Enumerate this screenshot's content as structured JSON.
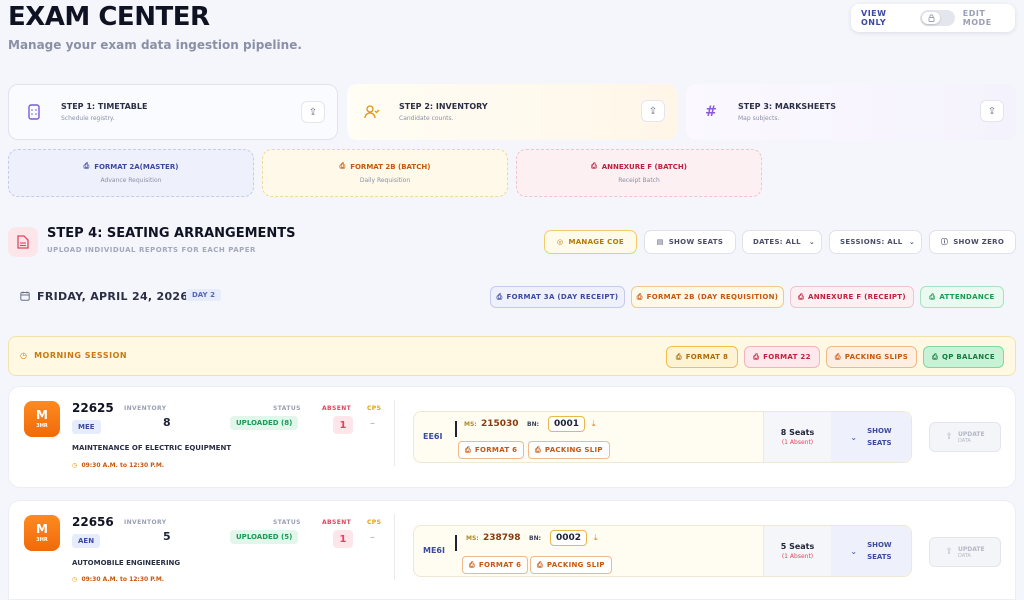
{
  "header": {
    "title": "EXAM CENTER",
    "subtitle": "Manage your exam data ingestion pipeline.",
    "mode_view": "VIEW ONLY",
    "mode_edit": "EDIT MODE"
  },
  "steps": [
    {
      "title": "STEP 1: TIMETABLE",
      "desc": "Schedule registry."
    },
    {
      "title": "STEP 2: INVENTORY",
      "desc": "Candidate counts."
    },
    {
      "title": "STEP 3: MARKSHEETS",
      "desc": "Map subjects."
    }
  ],
  "formats": [
    {
      "title": "FORMAT 2A(MASTER)",
      "desc": "Advance Requisition"
    },
    {
      "title": "FORMAT 2B (BATCH)",
      "desc": "Daily Requisition"
    },
    {
      "title": "ANNEXURE F (BATCH)",
      "desc": "Receipt Batch"
    }
  ],
  "step4": {
    "title": "STEP 4: SEATING ARRANGEMENTS",
    "subtitle": "UPLOAD INDIVIDUAL REPORTS FOR EACH PAPER",
    "manage_coe": "MANAGE COE",
    "show_seats": "SHOW SEATS",
    "dates_filter": "DATES: ALL",
    "sessions_filter": "SESSIONS: ALL",
    "show_zero": "SHOW ZERO"
  },
  "day": {
    "date": "FRIDAY, APRIL 24, 2026",
    "badge": "DAY 2",
    "actions": [
      "FORMAT 3A (DAY RECEIPT)",
      "FORMAT 2B (DAY REQUISITION)",
      "ANNEXURE F (RECEIPT)",
      "ATTENDANCE"
    ]
  },
  "session": {
    "label": "MORNING SESSION",
    "actions": [
      "FORMAT 8",
      "FORMAT 22",
      "PACKING SLIPS",
      "QP BALANCE"
    ]
  },
  "labels": {
    "inventory": "INVENTORY",
    "status": "STATUS",
    "absent": "ABSENT",
    "cps": "CPS",
    "ms": "MS:",
    "bn": "BN:",
    "format6": "FORMAT 6",
    "packing_slip": "PACKING SLIP",
    "show": "SHOW",
    "seats": "SEATS",
    "update": "UPDATE",
    "data": "DATA",
    "badge_letter": "M",
    "badge_hours": "3HR"
  },
  "papers": [
    {
      "code": "22625",
      "branch": "MEE",
      "inventory": "8",
      "status": "UPLOADED (8)",
      "absent": "1",
      "cps": "–",
      "name": "MAINTENANCE OF ELECTRIC EQUIPMENT",
      "time": "09:30 A.M. to 12:30 P.M.",
      "sub_code": "EE6I",
      "ms": "215030",
      "bn": "0001",
      "seats": "8 Seats",
      "seats_absent": "(1 Absent)"
    },
    {
      "code": "22656",
      "branch": "AEN",
      "inventory": "5",
      "status": "UPLOADED (5)",
      "absent": "1",
      "cps": "–",
      "name": "AUTOMOBILE ENGINEERING",
      "time": "09:30 A.M. to 12:30 P.M.",
      "sub_code": "ME6I",
      "ms": "238798",
      "bn": "0002",
      "seats": "5 Seats",
      "seats_absent": "(1 Absent)"
    }
  ],
  "icons": {
    "calendar": "calendar-icon",
    "printer": "printer-icon",
    "upload": "upload-icon",
    "download": "download-icon",
    "clock": "clock-icon"
  }
}
